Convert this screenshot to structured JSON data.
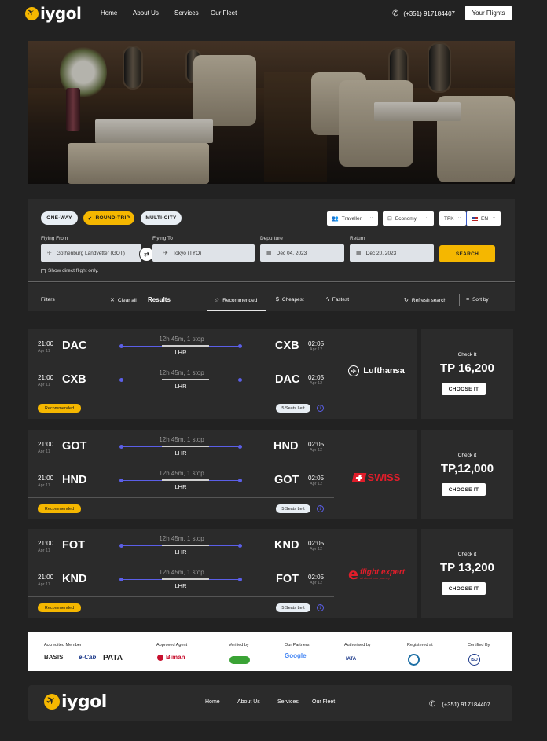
{
  "header": {
    "logo_text": "iygol",
    "nav": [
      "Home",
      "About Us",
      "Services",
      "Our Fleet"
    ],
    "phone": "(+351) 917184407",
    "flights_button": "Your Flights"
  },
  "search": {
    "trip_types": [
      "ONE-WAY",
      "ROUND-TRIP",
      "MULTI-CITY"
    ],
    "selected_trip": "ROUND-TRIP",
    "traveller": "Traveller",
    "cabin": "Economy",
    "currency": "TPK",
    "language": "EN",
    "from_label": "Flying From",
    "from_value": "Gothenburg Landvetter (GOT)",
    "to_label": "Flying To",
    "to_value": "Tokyo (TYO)",
    "depart_label": "Depurture",
    "depart_value": "Dec 04, 2023",
    "return_label": "Return",
    "return_value": "Dec 20, 2023",
    "search_button": "SEARCH",
    "direct_only": "Show direct flight only."
  },
  "filter_bar": {
    "filters": "Filters",
    "clear_all": "Clear all",
    "results": "Results",
    "recommended": "Recommended",
    "cheapest": "Cheapest",
    "fastest": "Fastest",
    "refresh": "Refresh search",
    "sort": "Sort by"
  },
  "results": [
    {
      "legs": [
        {
          "dep_time": "21:00",
          "dep_date": "Apr 11",
          "from": "DAC",
          "duration": "12h 45m, 1 stop",
          "via": "LHR",
          "to": "CXB",
          "arr_time": "02:05",
          "arr_date": "Apr 12"
        },
        {
          "dep_time": "21:00",
          "dep_date": "Apr 11",
          "from": "CXB",
          "duration": "12h 45m, 1 stop",
          "via": "LHR",
          "to": "DAC",
          "arr_time": "02:05",
          "arr_date": "Apr 12"
        }
      ],
      "badge": "Recommended",
      "seats": "5 Seats Left",
      "airline": "Lufthansa",
      "check": "Check It",
      "price": "TP 16,200",
      "choose": "CHOOSE IT"
    },
    {
      "legs": [
        {
          "dep_time": "21:00",
          "dep_date": "Apr 11",
          "from": "GOT",
          "duration": "12h 45m, 1 stop",
          "via": "LHR",
          "to": "HND",
          "arr_time": "02:05",
          "arr_date": "Apr 12"
        },
        {
          "dep_time": "21:00",
          "dep_date": "Apr 11",
          "from": "HND",
          "duration": "12h 45m, 1 stop",
          "via": "LHR",
          "to": "GOT",
          "arr_time": "02:05",
          "arr_date": "Apr 12"
        }
      ],
      "badge": "Recommended",
      "seats": "5 Seats Left",
      "airline": "SWISS",
      "check": "Check it",
      "price": "TP,12,000",
      "choose": "CHOOSE IT"
    },
    {
      "legs": [
        {
          "dep_time": "21:00",
          "dep_date": "Apr 11",
          "from": "FOT",
          "duration": "12h 45m, 1 stop",
          "via": "LHR",
          "to": "KND",
          "arr_time": "02:05",
          "arr_date": "Apr 12"
        },
        {
          "dep_time": "21:00",
          "dep_date": "Apr 11",
          "from": "KND",
          "duration": "12h 45m, 1 stop",
          "via": "LHR",
          "to": "FOT",
          "arr_time": "02:05",
          "arr_date": "Apr 12"
        }
      ],
      "badge": "Recommended",
      "seats": "5 Seats Left",
      "airline": "flight expert",
      "airline_tag": "all about your journey",
      "check": "Check it",
      "price": "TP 13,200",
      "choose": "CHOOSE IT"
    }
  ],
  "partners": {
    "accredited": "Accredited Member",
    "accredited_logos": [
      "BASIS",
      "e-Cab",
      "PATA"
    ],
    "approved": "Approved Agent",
    "approved_logo": "Biman",
    "verified": "Verified by",
    "partners": "Our Partners",
    "partners_logo": "Google",
    "authorised": "Authorised by",
    "authorised_logo": "IATA",
    "registered": "Registered at",
    "certified": "Certified By",
    "certified_logo": "ISO"
  },
  "footer": {
    "logo_text": "iygol",
    "nav": [
      "Home",
      "About Us",
      "Services",
      "Our Fleet"
    ],
    "phone": "(+351) 917184407"
  },
  "colors": {
    "accent": "#F5B700",
    "background": "#222222",
    "card": "#2b2b2b",
    "route_line": "#5b5fe8",
    "airline_red": "#e11d2a"
  }
}
